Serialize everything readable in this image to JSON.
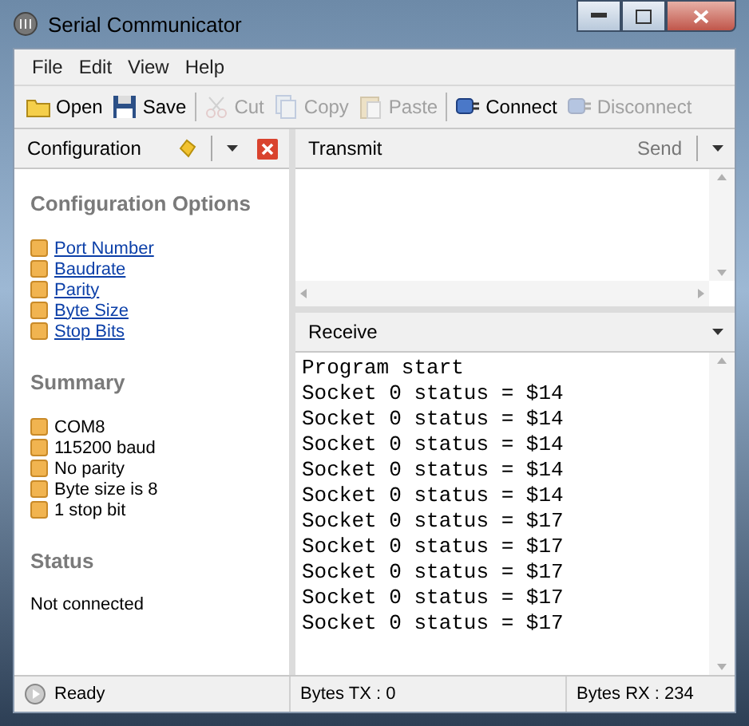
{
  "window": {
    "title": "Serial Communicator"
  },
  "menu": [
    "File",
    "Edit",
    "View",
    "Help"
  ],
  "toolbar": [
    {
      "kind": "button",
      "label": "Open",
      "disabled": false
    },
    {
      "kind": "button",
      "label": "Save",
      "disabled": false
    },
    {
      "kind": "separator"
    },
    {
      "kind": "button",
      "label": "Cut",
      "disabled": true
    },
    {
      "kind": "button",
      "label": "Copy",
      "disabled": true
    },
    {
      "kind": "button",
      "label": "Paste",
      "disabled": true
    },
    {
      "kind": "separator"
    },
    {
      "kind": "button",
      "label": "Connect",
      "disabled": false
    },
    {
      "kind": "button",
      "label": "Disconnect",
      "disabled": true
    }
  ],
  "configuration_panel": {
    "title": "Configuration",
    "sections": [
      {
        "heading": "Configuration Options",
        "kind": "links",
        "items": [
          "Port Number",
          "Baudrate",
          "Parity",
          "Byte Size",
          "Stop Bits"
        ]
      },
      {
        "heading": "Summary",
        "kind": "bullets",
        "items": [
          "COM8",
          "115200 baud",
          "No parity",
          "Byte size is 8",
          "1 stop bit"
        ]
      },
      {
        "heading": "Status",
        "kind": "text",
        "items": [
          "Not connected"
        ]
      }
    ]
  },
  "transmit_panel": {
    "title": "Transmit",
    "send_label": "Send"
  },
  "receive_panel": {
    "title": "Receive",
    "lines": [
      "Program start",
      "Socket 0 status = $14",
      "Socket 0 status = $14",
      "Socket 0 status = $14",
      "Socket 0 status = $14",
      "Socket 0 status = $14",
      "Socket 0 status = $17",
      "Socket 0 status = $17",
      "Socket 0 status = $17",
      "Socket 0 status = $17",
      "Socket 0 status = $17"
    ]
  },
  "status_bar": [
    "Ready",
    "Bytes TX : 0",
    "Bytes RX : 234"
  ]
}
